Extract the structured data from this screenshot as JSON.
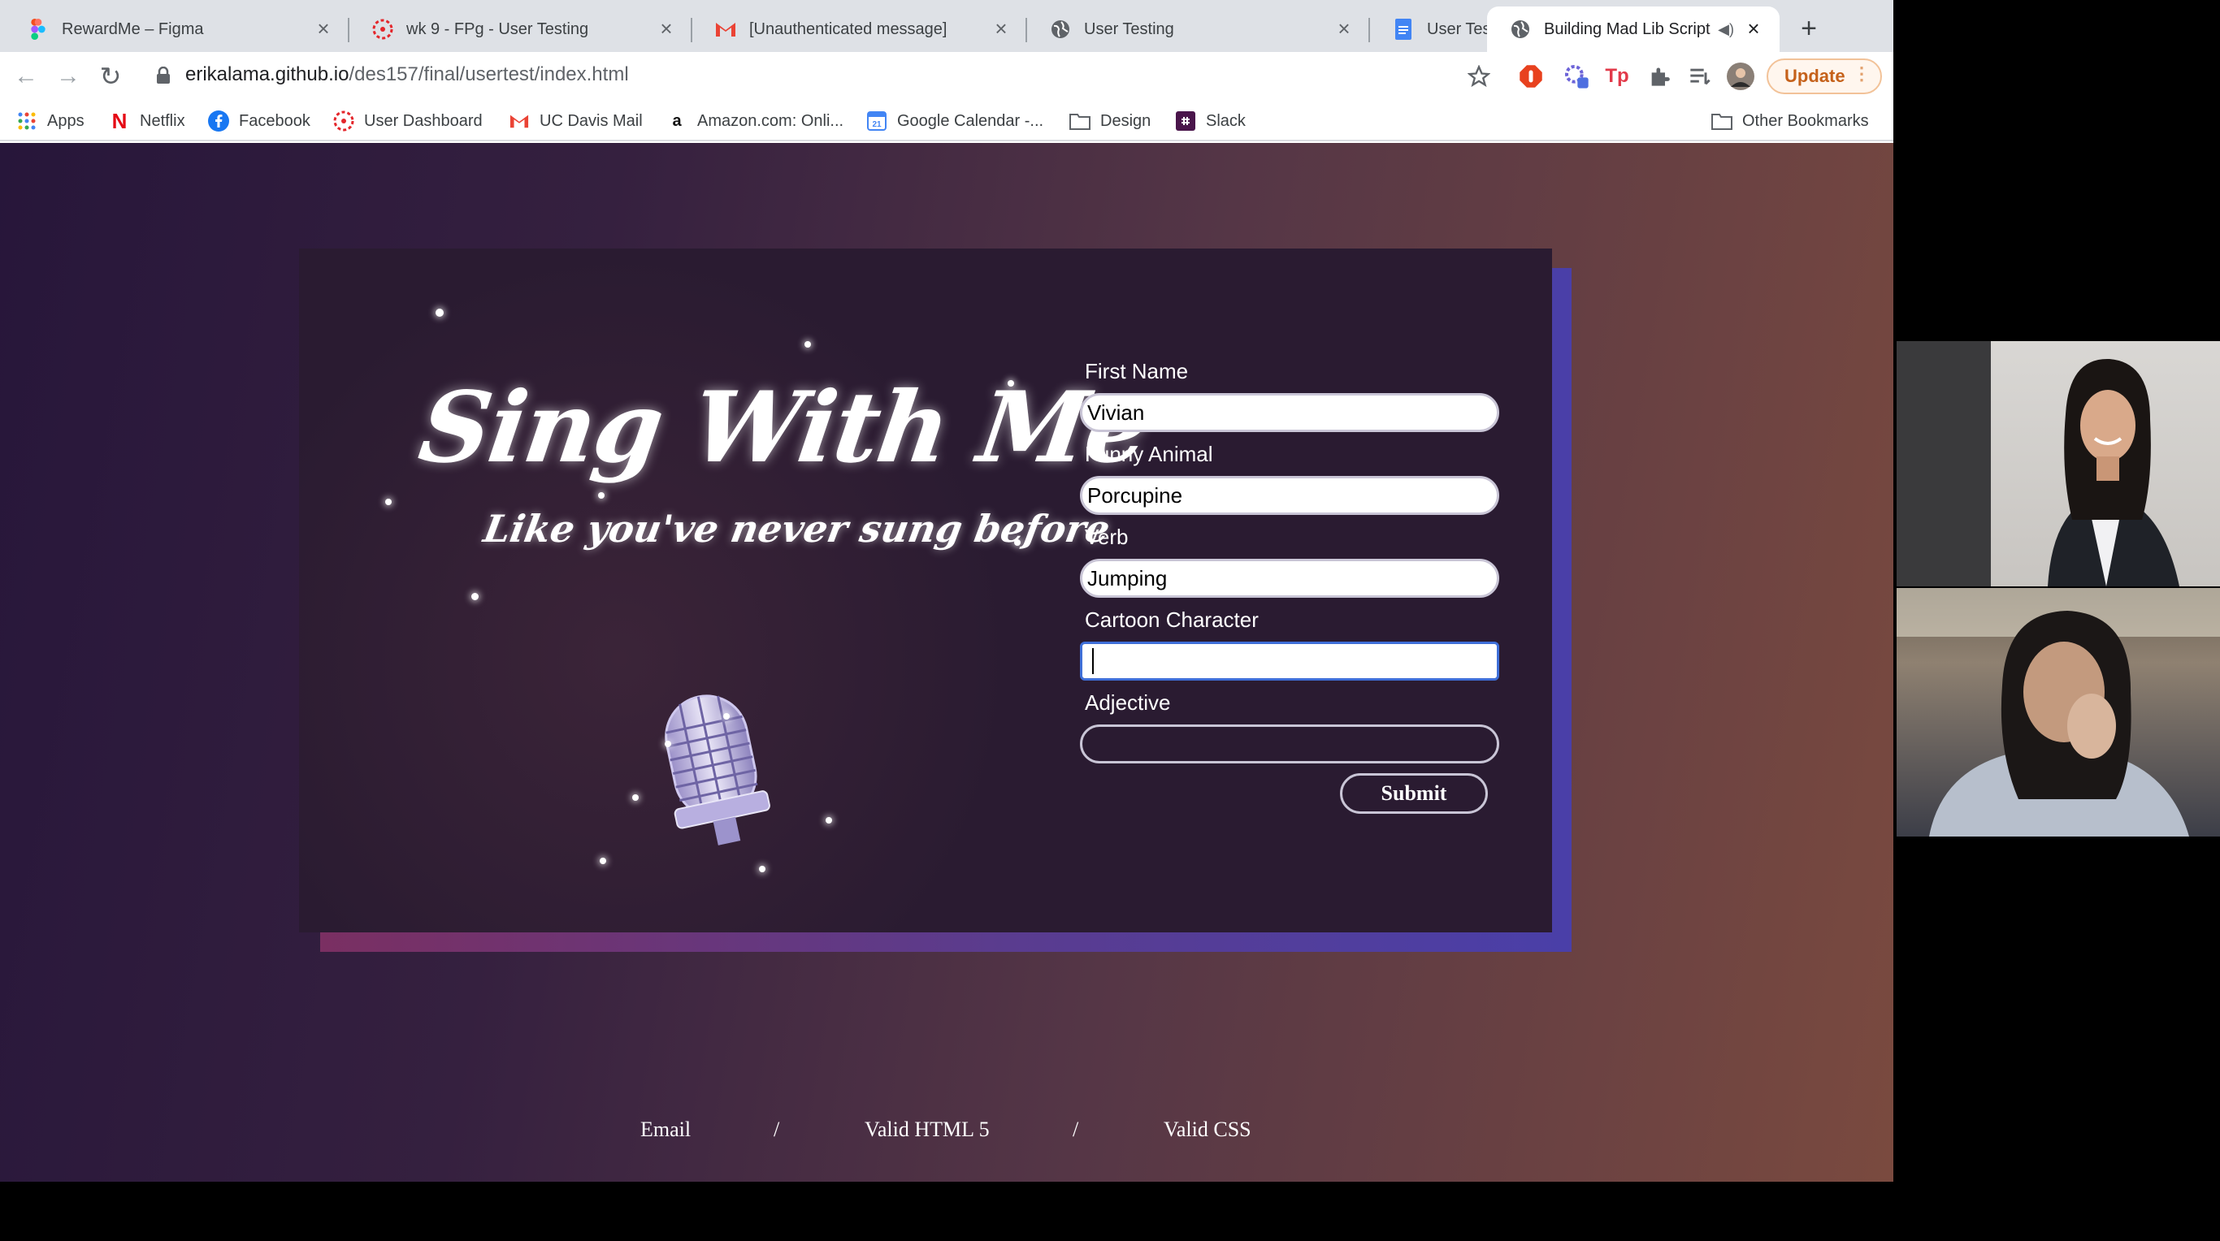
{
  "browser": {
    "tabs": [
      {
        "title": "RewardMe – Figma",
        "favicon": "figma-icon"
      },
      {
        "title": "wk 9 - FPg - User Testing",
        "favicon": "canvas-icon"
      },
      {
        "title": "[Unauthenticated message]",
        "favicon": "gmail-icon"
      },
      {
        "title": "User Testing",
        "favicon": "globe-icon"
      },
      {
        "title": "User Testing - Google Docs",
        "favicon": "google-docs-icon"
      },
      {
        "title": "Building Mad Lib Script",
        "favicon": "globe-icon",
        "active": true,
        "audio": true
      }
    ],
    "address": {
      "host": "erikalama.github.io",
      "path": "/des157/final/usertest/index.html"
    },
    "update_label": "Update",
    "bookmarks": [
      {
        "label": "Apps",
        "icon": "apps-grid-icon"
      },
      {
        "label": "Netflix",
        "icon": "netflix-icon"
      },
      {
        "label": "Facebook",
        "icon": "facebook-icon"
      },
      {
        "label": "User Dashboard",
        "icon": "canvas-icon"
      },
      {
        "label": "UC Davis Mail",
        "icon": "gmail-icon"
      },
      {
        "label": "Amazon.com: Onli...",
        "icon": "amazon-icon"
      },
      {
        "label": "Google Calendar -...",
        "icon": "calendar-icon"
      },
      {
        "label": "Design",
        "icon": "folder-icon"
      },
      {
        "label": "Slack",
        "icon": "slack-icon"
      }
    ],
    "other_bookmarks": "Other Bookmarks"
  },
  "page": {
    "headline": "Sing With Me",
    "subheadline": "Like you've never sung before",
    "form": {
      "fields": [
        {
          "label": "First Name",
          "value": "Vivian"
        },
        {
          "label": "Funny Animal",
          "value": "Porcupine"
        },
        {
          "label": "Verb",
          "value": "Jumping"
        },
        {
          "label": "Cartoon Character",
          "value": "",
          "focused": true
        },
        {
          "label": "Adjective",
          "value": ""
        }
      ],
      "submit_label": "Submit"
    },
    "footer": {
      "links": [
        "Email",
        "Valid HTML 5",
        "Valid CSS"
      ],
      "separator": "/"
    }
  },
  "colors": {
    "page_gradient": [
      "#27163a",
      "#7a4a3f"
    ],
    "card_bg": "#2a1b31",
    "card_shadow": [
      "#7a2f62",
      "#4a3fa8"
    ],
    "focus_ring": "#3f6fd8",
    "update_accent": "#c5611a"
  }
}
